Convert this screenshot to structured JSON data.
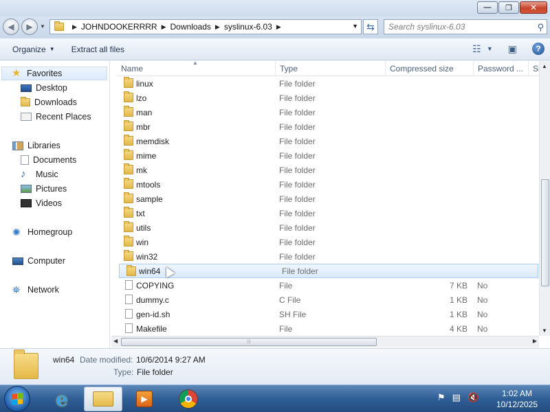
{
  "window": {
    "minimize_glyph": "—",
    "maximize_glyph": "❐",
    "close_glyph": "✕"
  },
  "address": {
    "crumbs": [
      "JOHNDOOKERRRR",
      "Downloads",
      "syslinux-6.03"
    ],
    "search_placeholder": "Search syslinux-6.03"
  },
  "toolbar": {
    "organize_label": "Organize",
    "extract_label": "Extract all files"
  },
  "nav": {
    "favorites": "Favorites",
    "desktop": "Desktop",
    "downloads": "Downloads",
    "recent": "Recent Places",
    "libraries": "Libraries",
    "documents": "Documents",
    "music": "Music",
    "pictures": "Pictures",
    "videos": "Videos",
    "homegroup": "Homegroup",
    "computer": "Computer",
    "network": "Network"
  },
  "columns": {
    "name": "Name",
    "type": "Type",
    "compressed": "Compressed size",
    "password": "Password ...",
    "size": "Si"
  },
  "files": [
    {
      "name": "linux",
      "type": "File folder",
      "csize": "",
      "pw": "",
      "kind": "folder"
    },
    {
      "name": "lzo",
      "type": "File folder",
      "csize": "",
      "pw": "",
      "kind": "folder"
    },
    {
      "name": "man",
      "type": "File folder",
      "csize": "",
      "pw": "",
      "kind": "folder"
    },
    {
      "name": "mbr",
      "type": "File folder",
      "csize": "",
      "pw": "",
      "kind": "folder"
    },
    {
      "name": "memdisk",
      "type": "File folder",
      "csize": "",
      "pw": "",
      "kind": "folder"
    },
    {
      "name": "mime",
      "type": "File folder",
      "csize": "",
      "pw": "",
      "kind": "folder"
    },
    {
      "name": "mk",
      "type": "File folder",
      "csize": "",
      "pw": "",
      "kind": "folder"
    },
    {
      "name": "mtools",
      "type": "File folder",
      "csize": "",
      "pw": "",
      "kind": "folder"
    },
    {
      "name": "sample",
      "type": "File folder",
      "csize": "",
      "pw": "",
      "kind": "folder"
    },
    {
      "name": "txt",
      "type": "File folder",
      "csize": "",
      "pw": "",
      "kind": "folder"
    },
    {
      "name": "utils",
      "type": "File folder",
      "csize": "",
      "pw": "",
      "kind": "folder"
    },
    {
      "name": "win",
      "type": "File folder",
      "csize": "",
      "pw": "",
      "kind": "folder"
    },
    {
      "name": "win32",
      "type": "File folder",
      "csize": "",
      "pw": "",
      "kind": "folder"
    },
    {
      "name": "win64",
      "type": "File folder",
      "csize": "",
      "pw": "",
      "kind": "folder",
      "selected": true
    },
    {
      "name": "COPYING",
      "type": "File",
      "csize": "7 KB",
      "pw": "No",
      "kind": "file"
    },
    {
      "name": "dummy.c",
      "type": "C File",
      "csize": "1 KB",
      "pw": "No",
      "kind": "file"
    },
    {
      "name": "gen-id.sh",
      "type": "SH File",
      "csize": "1 KB",
      "pw": "No",
      "kind": "file"
    },
    {
      "name": "Makefile",
      "type": "File",
      "csize": "4 KB",
      "pw": "No",
      "kind": "file"
    }
  ],
  "details": {
    "name": "win64",
    "modified_label": "Date modified:",
    "modified_value": "10/6/2014 9:27 AM",
    "type_label": "Type:",
    "type_value": "File folder"
  },
  "taskbar": {
    "time": "1:02 AM",
    "date": "10/12/2025"
  },
  "colors": {
    "selection": "#dbeafa",
    "taskbar": "#2f5f97",
    "folder": "#e2b84a"
  }
}
